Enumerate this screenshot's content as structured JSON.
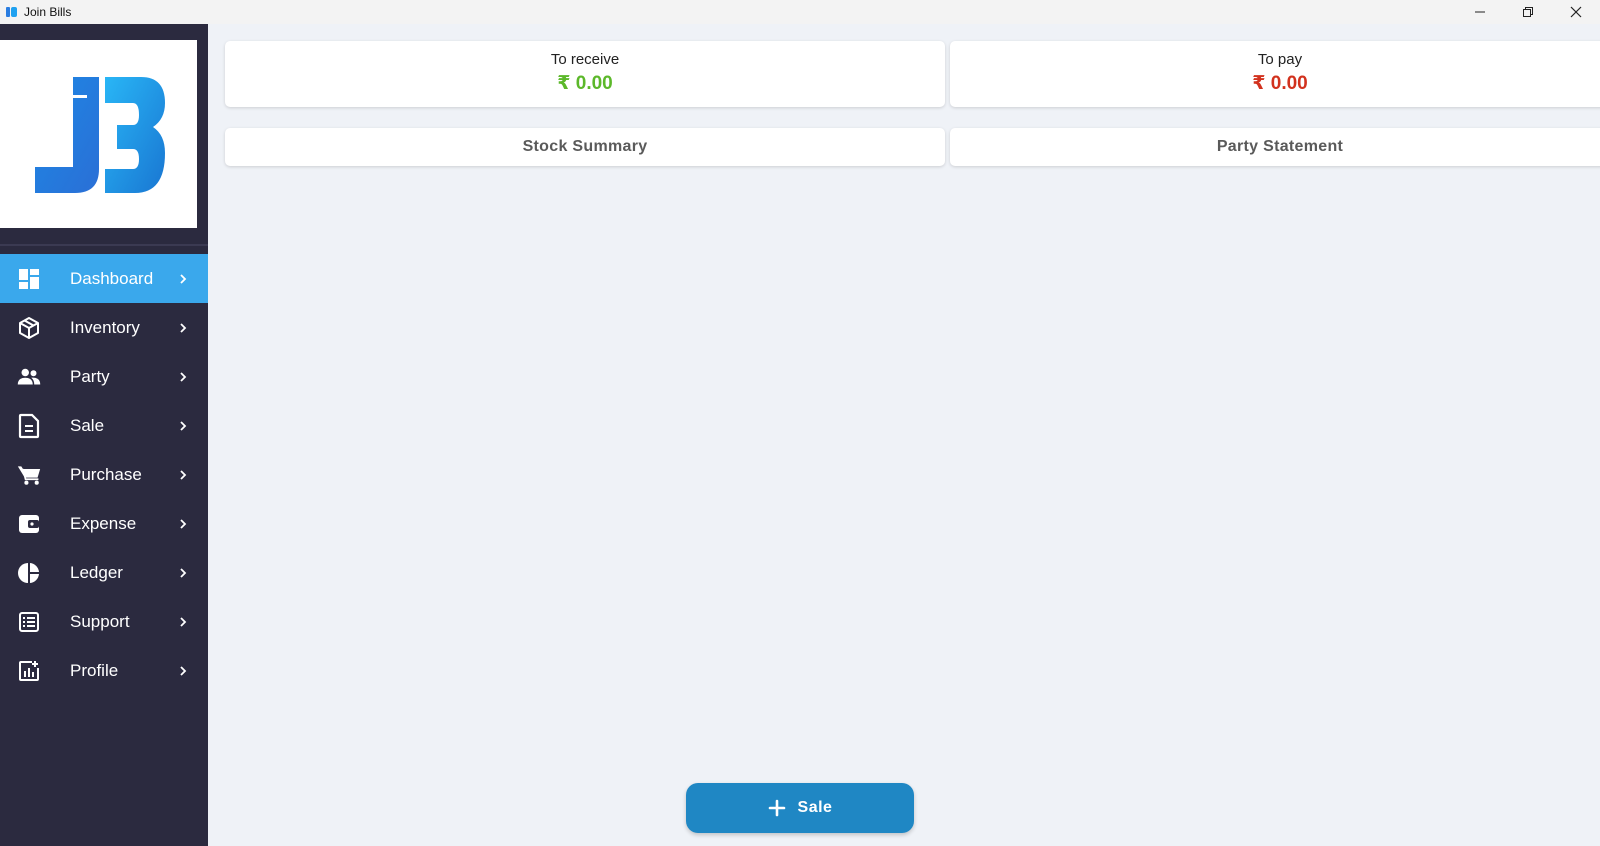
{
  "window": {
    "title": "Join Bills",
    "controls": {
      "minimize_icon": "minimize-icon",
      "restore_icon": "restore-icon",
      "close_icon": "close-icon"
    }
  },
  "sidebar": {
    "logo_icon": "jb-logo",
    "items": [
      {
        "label": "Dashboard",
        "icon": "dashboard-icon",
        "active": true
      },
      {
        "label": "Inventory",
        "icon": "box-icon",
        "active": false
      },
      {
        "label": "Party",
        "icon": "users-icon",
        "active": false
      },
      {
        "label": "Sale",
        "icon": "document-icon",
        "active": false
      },
      {
        "label": "Purchase",
        "icon": "cart-icon",
        "active": false
      },
      {
        "label": "Expense",
        "icon": "wallet-icon",
        "active": false
      },
      {
        "label": "Ledger",
        "icon": "pie-chart-icon",
        "active": false
      },
      {
        "label": "Support",
        "icon": "list-icon",
        "active": false
      },
      {
        "label": "Profile",
        "icon": "report-icon",
        "active": false
      }
    ],
    "colors": {
      "background": "#2b2a3f",
      "active": "#3aa8ec"
    }
  },
  "summary": {
    "to_receive": {
      "label": "To receive",
      "value": "₹ 0.00",
      "color": "#5cb82a"
    },
    "to_pay": {
      "label": "To pay",
      "value": "₹ 0.00",
      "color": "#d2321e"
    }
  },
  "links": {
    "stock_summary": "Stock Summary",
    "party_statement": "Party Statement"
  },
  "fab": {
    "label": "Sale",
    "icon": "plus-icon",
    "color": "#1f87c4"
  }
}
